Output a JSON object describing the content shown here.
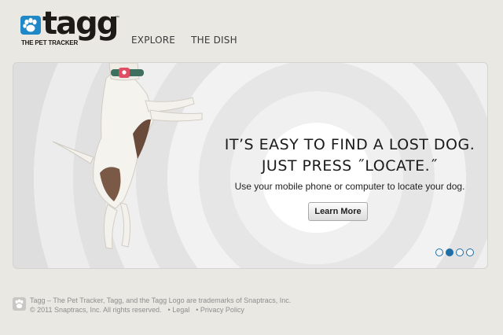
{
  "brand": {
    "logo_word": "tagg",
    "trademark": "™",
    "tagline": "THE PET TRACKER",
    "color": "#1f89c7"
  },
  "nav": {
    "items": [
      {
        "label": "EXPLORE"
      },
      {
        "label": "THE DISH"
      }
    ]
  },
  "hero": {
    "headline_line1": "IT’S EASY TO FIND A LOST DOG.",
    "headline_line2": "JUST PRESS ˝LOCATE.˝",
    "subtext": "Use your mobile phone or computer to locate your dog.",
    "button_label": "Learn More",
    "slides_total": 4,
    "active_slide": 2,
    "accent_color": "#1f6fa6"
  },
  "footer": {
    "line1": "Tagg – The Pet Tracker, Tagg, and the Tagg Logo are trademarks of Snaptracs, Inc.",
    "copyright": "© 2011 Snaptracs, Inc. All rights reserved.",
    "legal_link": "• Legal",
    "privacy_link": "• Privacy Policy"
  }
}
